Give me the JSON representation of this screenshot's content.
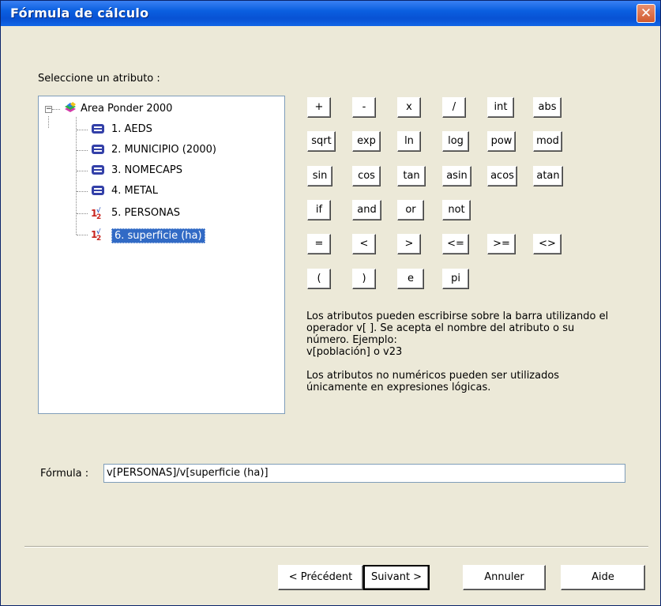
{
  "window": {
    "title": "Fórmula de cálculo",
    "close_glyph": "✕"
  },
  "attribute_label": "Seleccione un atributo :",
  "tree": {
    "root": {
      "label": "Area Ponder 2000",
      "icon": "layer-icon",
      "expander": "−"
    },
    "items": [
      {
        "label": "1. AEDS",
        "icon": "text-attribute-icon"
      },
      {
        "label": "2. MUNICIPIO (2000)",
        "icon": "text-attribute-icon"
      },
      {
        "label": "3. NOMECAPS",
        "icon": "text-attribute-icon"
      },
      {
        "label": "4. METAL",
        "icon": "text-attribute-icon"
      },
      {
        "label": "5. PERSONAS",
        "icon": "numeric-attribute-icon"
      },
      {
        "label": "6. superficie (ha)",
        "icon": "numeric-attribute-icon",
        "selected": true
      }
    ]
  },
  "operators": {
    "row1": [
      "+",
      "-",
      "x",
      "/",
      "int",
      "abs"
    ],
    "row2": [
      "sqrt",
      "exp",
      "ln",
      "log",
      "pow",
      "mod"
    ],
    "row3": [
      "sin",
      "cos",
      "tan",
      "asin",
      "acos",
      "atan"
    ],
    "row4": [
      "if",
      "and",
      "or",
      "not"
    ],
    "row5": [
      "=",
      "<",
      ">",
      "<=",
      ">=",
      "<>"
    ],
    "row6": [
      "(",
      ")",
      "e",
      "pi"
    ]
  },
  "help": {
    "p1": "Los atributos pueden escribirse sobre la barra utilizando el\noperador v[ ]. Se acepta el nombre del atributo o su\nnúmero. Ejemplo:\nv[población] o v23",
    "p2": "Los atributos no numéricos pueden ser utilizados\núnicamente en expresiones lógicas."
  },
  "formula": {
    "label": "Fórmula :",
    "value": "v[PERSONAS]/v[superficie (ha)]"
  },
  "buttons": {
    "prev": "< Précédent",
    "next": "Suivant >",
    "cancel": "Annuler",
    "help": "Aide"
  },
  "colors": {
    "titlebar": "#0852d4",
    "selection": "#316ac5",
    "dialog_bg": "#ece9d8"
  }
}
